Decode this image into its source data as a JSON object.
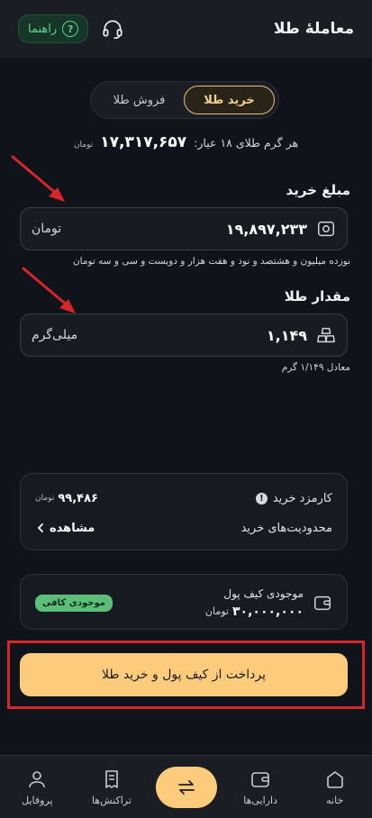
{
  "header": {
    "title": "معاملهٔ طلا",
    "guide_label": "راهنما",
    "guide_glyph": "?"
  },
  "tabs": [
    {
      "label": "خرید طلا",
      "active": true
    },
    {
      "label": "فروش طلا",
      "active": false
    }
  ],
  "price": {
    "label": "هر گرم طلای ۱۸ عیار:",
    "value": "۱۷,۳۱۷,۶۵۷",
    "unit": "تومان"
  },
  "purchase_amount": {
    "label": "مبلغ خرید",
    "value": "۱۹,۸۹۷,۲۳۳",
    "unit": "تومان",
    "words": "نوزده میلیون و هشتصد و نود و هفت هزار و دویست و سی و سه تومان"
  },
  "gold_amount": {
    "label": "مقدار طلا",
    "value": "۱,۱۴۹",
    "unit": "میلی‌گرم",
    "equivalent": "معادل ۱/۱۴۹ گرم"
  },
  "fees": {
    "fee_label": "کارمزد خرید",
    "fee_value": "۹۹,۴۸۶",
    "fee_unit": "تومان",
    "limits_label": "محدودیت‌های خرید",
    "view_label": "مشاهده"
  },
  "wallet": {
    "label": "موجودی کیف پول",
    "value": "۳۰,۰۰۰,۰۰۰",
    "unit": "تومان",
    "badge": "موجودی کافی"
  },
  "pay_button": {
    "label": "پرداخت از کیف پول و خرید طلا"
  },
  "nav": [
    {
      "label": "خانه",
      "icon": "home-icon"
    },
    {
      "label": "دارایی‌ها",
      "icon": "wallet-icon"
    },
    {
      "label": "",
      "icon": "swap-icon"
    },
    {
      "label": "تراکنش‌ها",
      "icon": "receipt-icon"
    },
    {
      "label": "پروفایل",
      "icon": "user-icon"
    }
  ],
  "colors": {
    "accent": "#fccc7c",
    "background": "#10131a",
    "success": "#5bbf7a",
    "arrow": "#d7262a"
  }
}
